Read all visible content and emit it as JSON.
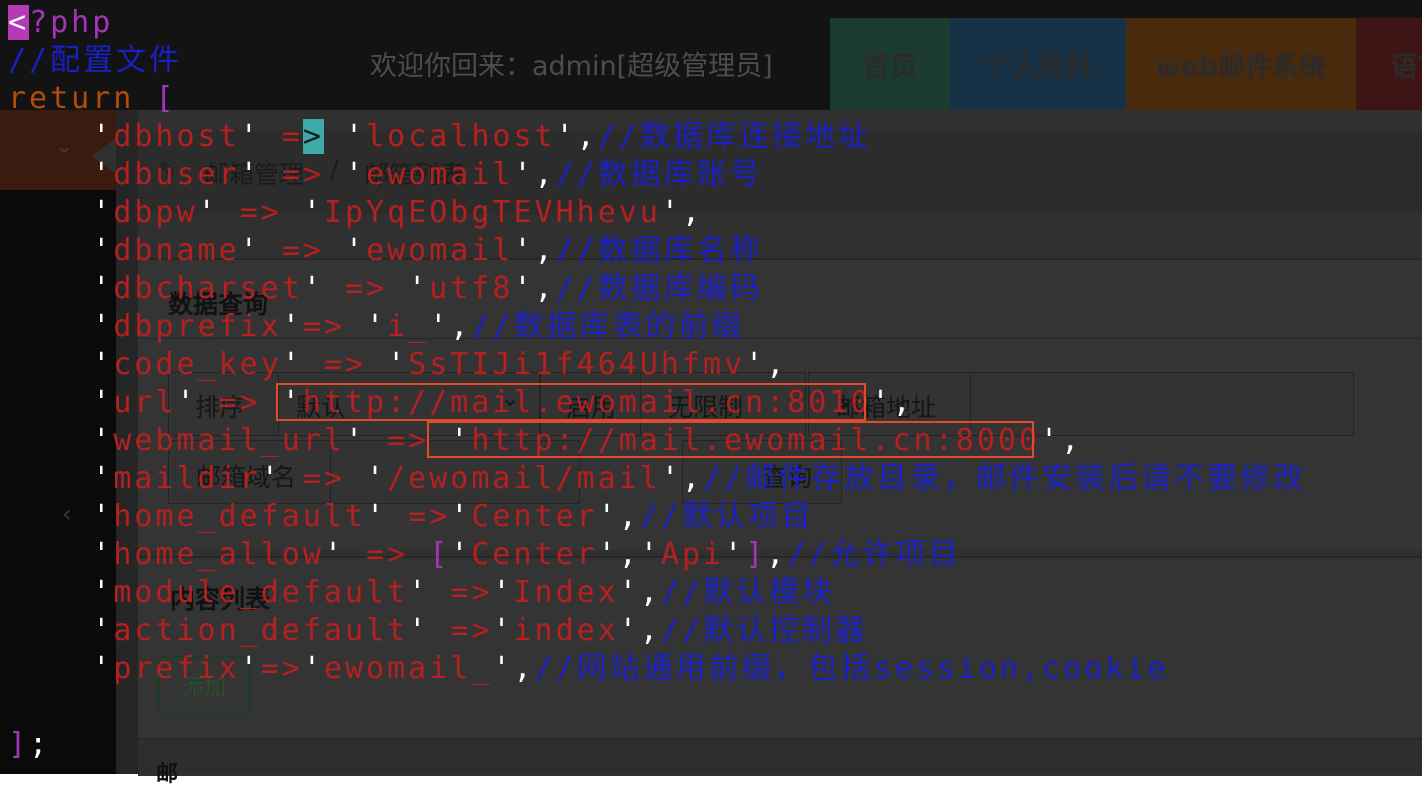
{
  "header": {
    "welcome_text": "欢迎你回来：admin[超级管理员]",
    "nav": [
      {
        "label": "首页",
        "color": "#1b3b2f"
      },
      {
        "label": "个人资料",
        "color": "#173246"
      },
      {
        "label": "web邮件系统",
        "color": "#4a2a0c"
      },
      {
        "label": "语言",
        "color": "#3f1414"
      }
    ]
  },
  "breadcrumb": {
    "items": [
      "邮箱管理",
      "邮箱列表"
    ],
    "separator": "/"
  },
  "query": {
    "title": "数据查询",
    "sort_label": "排序",
    "sort_value": "默认",
    "status_label": "启用",
    "status_value": "无限制",
    "email_label": "邮箱地址",
    "domain_label": "邮箱域名",
    "search_label": "查询"
  },
  "list": {
    "title": "内容列表",
    "add_label": "添加",
    "header_first": "邮"
  },
  "code": {
    "lines": [
      [
        {
          "t": "<",
          "c": "cur-pink"
        },
        {
          "t": "?php",
          "c": "m"
        }
      ],
      [
        {
          "t": "//配置文件",
          "c": "c"
        }
      ],
      [
        {
          "t": "return ",
          "c": "k"
        },
        {
          "t": "[",
          "c": "m"
        }
      ],
      [
        {
          "t": "    ",
          "c": "p"
        },
        {
          "t": "'",
          "c": "p"
        },
        {
          "t": "dbhost",
          "c": "s"
        },
        {
          "t": "' ",
          "c": "p"
        },
        {
          "t": "=",
          "c": "s"
        },
        {
          "t": ">",
          "c": "cur-teal"
        },
        {
          "t": " '",
          "c": "p"
        },
        {
          "t": "localhost",
          "c": "s"
        },
        {
          "t": "',",
          "c": "p"
        },
        {
          "t": "//数据库连接地址",
          "c": "c"
        }
      ],
      [
        {
          "t": "    ",
          "c": "p"
        },
        {
          "t": "'",
          "c": "p"
        },
        {
          "t": "dbuser",
          "c": "s"
        },
        {
          "t": "' ",
          "c": "p"
        },
        {
          "t": "=>",
          "c": "s"
        },
        {
          "t": " '",
          "c": "p"
        },
        {
          "t": "ewomail",
          "c": "s"
        },
        {
          "t": "',",
          "c": "p"
        },
        {
          "t": "//数据库账号",
          "c": "c"
        }
      ],
      [
        {
          "t": "    ",
          "c": "p"
        },
        {
          "t": "'",
          "c": "p"
        },
        {
          "t": "dbpw",
          "c": "s"
        },
        {
          "t": "' ",
          "c": "p"
        },
        {
          "t": "=>",
          "c": "s"
        },
        {
          "t": " '",
          "c": "p"
        },
        {
          "t": "IpYqEObgTEVHhevu",
          "c": "s"
        },
        {
          "t": "',",
          "c": "p"
        }
      ],
      [
        {
          "t": "    ",
          "c": "p"
        },
        {
          "t": "'",
          "c": "p"
        },
        {
          "t": "dbname",
          "c": "s"
        },
        {
          "t": "' ",
          "c": "p"
        },
        {
          "t": "=>",
          "c": "s"
        },
        {
          "t": " '",
          "c": "p"
        },
        {
          "t": "ewomail",
          "c": "s"
        },
        {
          "t": "',",
          "c": "p"
        },
        {
          "t": "//数据库名称",
          "c": "c"
        }
      ],
      [
        {
          "t": "    ",
          "c": "p"
        },
        {
          "t": "'",
          "c": "p"
        },
        {
          "t": "dbcharset",
          "c": "s"
        },
        {
          "t": "' ",
          "c": "p"
        },
        {
          "t": "=>",
          "c": "s"
        },
        {
          "t": " '",
          "c": "p"
        },
        {
          "t": "utf8",
          "c": "s"
        },
        {
          "t": "',",
          "c": "p"
        },
        {
          "t": "//数据库编码",
          "c": "c"
        }
      ],
      [
        {
          "t": "    ",
          "c": "p"
        },
        {
          "t": "'",
          "c": "p"
        },
        {
          "t": "dbprefix",
          "c": "s"
        },
        {
          "t": "'",
          "c": "p"
        },
        {
          "t": "=>",
          "c": "s"
        },
        {
          "t": " '",
          "c": "p"
        },
        {
          "t": "i_",
          "c": "s"
        },
        {
          "t": "',",
          "c": "p"
        },
        {
          "t": "//数据库表的前缀",
          "c": "c"
        }
      ],
      [
        {
          "t": "    ",
          "c": "p"
        },
        {
          "t": "'",
          "c": "p"
        },
        {
          "t": "code_key",
          "c": "s"
        },
        {
          "t": "' ",
          "c": "p"
        },
        {
          "t": "=>",
          "c": "s"
        },
        {
          "t": " '",
          "c": "p"
        },
        {
          "t": "SsTIJi1f464Uhfmv",
          "c": "s"
        },
        {
          "t": "',",
          "c": "p"
        }
      ],
      [
        {
          "t": "    ",
          "c": "p"
        },
        {
          "t": "'",
          "c": "p"
        },
        {
          "t": "url",
          "c": "s"
        },
        {
          "t": "' ",
          "c": "p"
        },
        {
          "t": "=>",
          "c": "s"
        },
        {
          "t": " '",
          "c": "p"
        },
        {
          "t": "http://mail.ewomail.cn:8010",
          "c": "s"
        },
        {
          "t": "',",
          "c": "p"
        }
      ],
      [
        {
          "t": "    ",
          "c": "p"
        },
        {
          "t": "'",
          "c": "p"
        },
        {
          "t": "webmail_url",
          "c": "s"
        },
        {
          "t": "' ",
          "c": "p"
        },
        {
          "t": "=>",
          "c": "s"
        },
        {
          "t": " '",
          "c": "p"
        },
        {
          "t": "http://mail.ewomail.cn:8000",
          "c": "s"
        },
        {
          "t": "',",
          "c": "p"
        }
      ],
      [
        {
          "t": "    ",
          "c": "p"
        },
        {
          "t": "'",
          "c": "p"
        },
        {
          "t": "maildir",
          "c": "s"
        },
        {
          "t": "' ",
          "c": "p"
        },
        {
          "t": "=>",
          "c": "s"
        },
        {
          "t": " '",
          "c": "p"
        },
        {
          "t": "/ewomail/mail",
          "c": "s"
        },
        {
          "t": "',",
          "c": "p"
        },
        {
          "t": "//邮件存放目录，邮件安装后请不要修改",
          "c": "c"
        }
      ],
      [
        {
          "t": "    ",
          "c": "p"
        },
        {
          "t": "'",
          "c": "p"
        },
        {
          "t": "home_default",
          "c": "s"
        },
        {
          "t": "' ",
          "c": "p"
        },
        {
          "t": "=>",
          "c": "s"
        },
        {
          "t": "'",
          "c": "p"
        },
        {
          "t": "Center",
          "c": "s"
        },
        {
          "t": "',",
          "c": "p"
        },
        {
          "t": "//默认项目",
          "c": "c"
        }
      ],
      [
        {
          "t": "    ",
          "c": "p"
        },
        {
          "t": "'",
          "c": "p"
        },
        {
          "t": "home_allow",
          "c": "s"
        },
        {
          "t": "' ",
          "c": "p"
        },
        {
          "t": "=>",
          "c": "s"
        },
        {
          "t": " ",
          "c": "p"
        },
        {
          "t": "[",
          "c": "m"
        },
        {
          "t": "'",
          "c": "p"
        },
        {
          "t": "Center",
          "c": "s"
        },
        {
          "t": "','",
          "c": "p"
        },
        {
          "t": "Api",
          "c": "s"
        },
        {
          "t": "'",
          "c": "p"
        },
        {
          "t": "]",
          "c": "m"
        },
        {
          "t": ",",
          "c": "p"
        },
        {
          "t": "//允许项目",
          "c": "c"
        }
      ],
      [
        {
          "t": "    ",
          "c": "p"
        },
        {
          "t": "'",
          "c": "p"
        },
        {
          "t": "module_default",
          "c": "s"
        },
        {
          "t": "' ",
          "c": "p"
        },
        {
          "t": "=>",
          "c": "s"
        },
        {
          "t": "'",
          "c": "p"
        },
        {
          "t": "Index",
          "c": "s"
        },
        {
          "t": "',",
          "c": "p"
        },
        {
          "t": "//默认模块",
          "c": "c"
        }
      ],
      [
        {
          "t": "    ",
          "c": "p"
        },
        {
          "t": "'",
          "c": "p"
        },
        {
          "t": "action_default",
          "c": "s"
        },
        {
          "t": "' ",
          "c": "p"
        },
        {
          "t": "=>",
          "c": "s"
        },
        {
          "t": "'",
          "c": "p"
        },
        {
          "t": "index",
          "c": "s"
        },
        {
          "t": "',",
          "c": "p"
        },
        {
          "t": "//默认控制器",
          "c": "c"
        }
      ],
      [
        {
          "t": "    ",
          "c": "p"
        },
        {
          "t": "'",
          "c": "p"
        },
        {
          "t": "prefix",
          "c": "s"
        },
        {
          "t": "'",
          "c": "p"
        },
        {
          "t": "=>",
          "c": "s"
        },
        {
          "t": "'",
          "c": "p"
        },
        {
          "t": "ewomail_",
          "c": "s"
        },
        {
          "t": "',",
          "c": "p"
        },
        {
          "t": "//网站通用前缀，包括session,cookie",
          "c": "c"
        }
      ],
      [],
      [
        {
          "t": "]",
          "c": "m"
        },
        {
          "t": ";",
          "c": "p"
        }
      ]
    ]
  }
}
